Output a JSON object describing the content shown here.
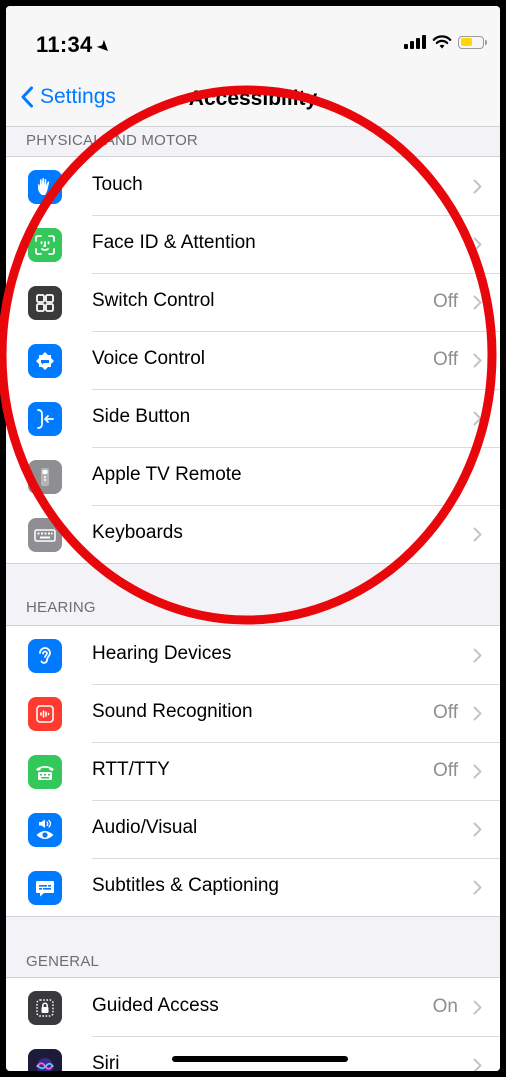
{
  "status_bar": {
    "time": "11:34"
  },
  "nav": {
    "back_label": "Settings",
    "title": "Accessibility"
  },
  "sections": [
    {
      "header": "PHYSICAL AND MOTOR",
      "rows": [
        {
          "label": "Touch",
          "value": "",
          "icon": "hand-touch-icon",
          "color": "#007aff"
        },
        {
          "label": "Face ID & Attention",
          "value": "",
          "icon": "face-id-icon",
          "color": "#34c759"
        },
        {
          "label": "Switch Control",
          "value": "Off",
          "icon": "switch-control-icon",
          "color": "#3a3a3c"
        },
        {
          "label": "Voice Control",
          "value": "Off",
          "icon": "voice-control-icon",
          "color": "#007aff"
        },
        {
          "label": "Side Button",
          "value": "",
          "icon": "side-button-icon",
          "color": "#007aff"
        },
        {
          "label": "Apple TV Remote",
          "value": "",
          "icon": "tv-remote-icon",
          "color": "#8e8e93"
        },
        {
          "label": "Keyboards",
          "value": "",
          "icon": "keyboard-icon",
          "color": "#8e8e93"
        }
      ]
    },
    {
      "header": "HEARING",
      "rows": [
        {
          "label": "Hearing Devices",
          "value": "",
          "icon": "ear-icon",
          "color": "#007aff"
        },
        {
          "label": "Sound Recognition",
          "value": "Off",
          "icon": "sound-recognition-icon",
          "color": "#ff3b30"
        },
        {
          "label": "RTT/TTY",
          "value": "Off",
          "icon": "tty-icon",
          "color": "#34c759"
        },
        {
          "label": "Audio/Visual",
          "value": "",
          "icon": "audio-visual-icon",
          "color": "#007aff"
        },
        {
          "label": "Subtitles & Captioning",
          "value": "",
          "icon": "captions-icon",
          "color": "#007aff"
        }
      ]
    },
    {
      "header": "GENERAL",
      "rows": [
        {
          "label": "Guided Access",
          "value": "On",
          "icon": "guided-access-icon",
          "color": "#3a3a3c"
        },
        {
          "label": "Siri",
          "value": "",
          "icon": "siri-icon",
          "color": "#1c1c3a"
        }
      ]
    }
  ],
  "colors": {
    "accent": "#007aff",
    "annotation": "#e8070b",
    "battery": "#ffd60a"
  }
}
